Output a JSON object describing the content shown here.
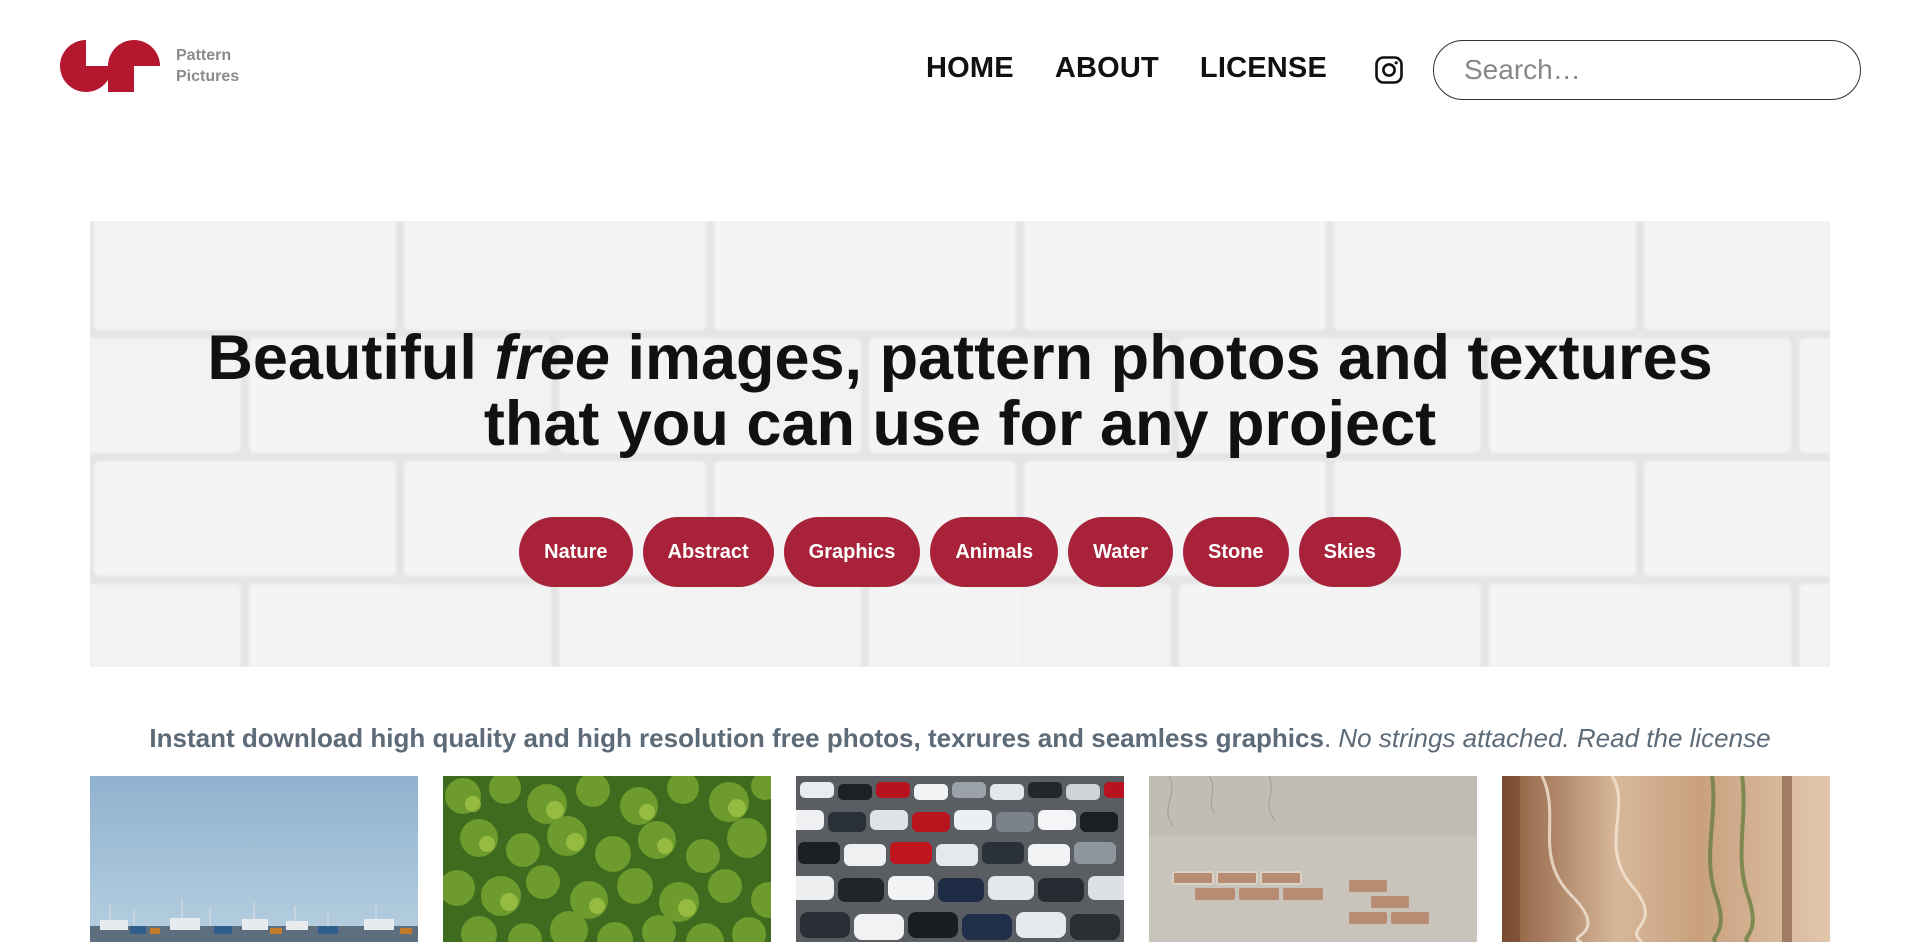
{
  "brand": {
    "line1": "Pattern",
    "line2": "Pictures",
    "color": "#b5172f"
  },
  "nav": {
    "items": [
      {
        "label": "HOME"
      },
      {
        "label": "ABOUT"
      },
      {
        "label": "LICENSE"
      }
    ],
    "instagram_icon": "instagram-icon"
  },
  "search": {
    "placeholder": "Search…"
  },
  "hero": {
    "title_part1": "Beautiful ",
    "title_em": "free",
    "title_part2": " images, pattern photos and textures",
    "title_line2": "that you can use for any project",
    "tags": [
      {
        "label": "Nature"
      },
      {
        "label": "Abstract"
      },
      {
        "label": "Graphics"
      },
      {
        "label": "Animals"
      },
      {
        "label": "Water"
      },
      {
        "label": "Stone"
      },
      {
        "label": "Skies"
      }
    ],
    "tag_color": "#a8233a"
  },
  "tagline": {
    "strong": "Instant download high quality and high resolution free photos, texrures and seamless graphics",
    "sep": ". ",
    "em": "No strings attached. ",
    "link": "Read the license"
  },
  "thumbnails": [
    {
      "subject": "harbor-boats"
    },
    {
      "subject": "green-ivy-leaves"
    },
    {
      "subject": "parking-lot-cars"
    },
    {
      "subject": "old-brick-wall"
    },
    {
      "subject": "aerial-sand-water"
    }
  ]
}
